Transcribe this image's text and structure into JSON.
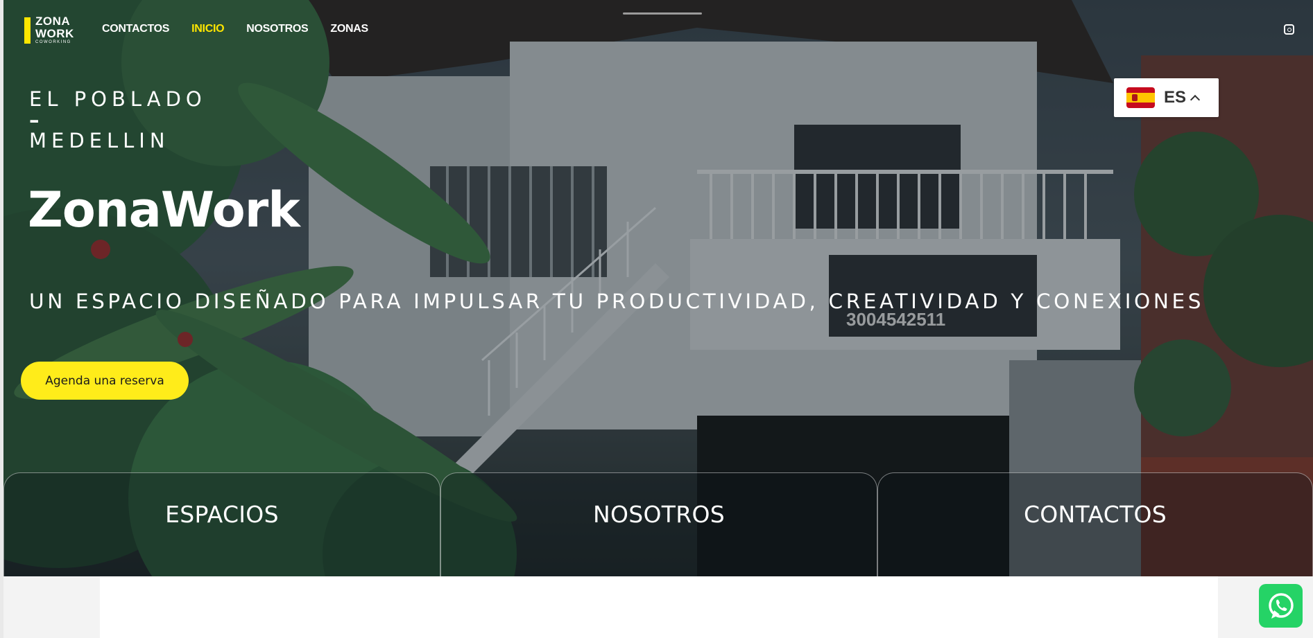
{
  "logo": {
    "line1": "ZONA",
    "line2": "WORK",
    "sub": "COWORKING"
  },
  "nav": {
    "items": [
      {
        "label": "CONTACTOS"
      },
      {
        "label": "INICIO"
      },
      {
        "label": "NOSOTROS"
      },
      {
        "label": "ZONAS"
      }
    ],
    "active_index": 1
  },
  "language": {
    "code": "ES",
    "flag": "spain-flag-icon"
  },
  "hero": {
    "location_line1": "EL POBLADO",
    "location_sep": "–",
    "location_line2": "MEDELLIN",
    "title": "ZonaWork",
    "tagline": "UN ESPACIO DISEÑADO PARA IMPULSAR TU PRODUCTIVIDAD, CREATIVIDAD Y CONEXIONES",
    "cta_label": "Agenda una reserva",
    "sign_text": "3004542511"
  },
  "cards": [
    {
      "label": "ESPACIOS"
    },
    {
      "label": "NOSOTROS"
    },
    {
      "label": "CONTACTOS"
    }
  ],
  "colors": {
    "accent": "#ffe600",
    "cta": "#ffec1a",
    "whatsapp": "#25d366"
  },
  "icons": {
    "social": "instagram-icon",
    "chat": "whatsapp-icon",
    "dropdown": "chevron-up-icon"
  }
}
